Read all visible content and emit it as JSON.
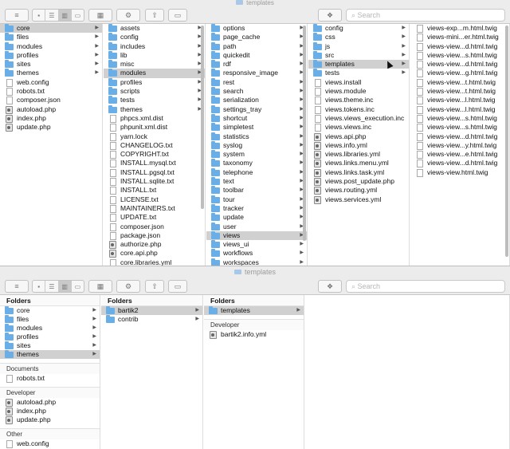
{
  "window_title": "templates",
  "search_placeholder": "Search",
  "toolbar": {
    "back_glyph": "≡",
    "view_list": "☰",
    "view_icons": "▦",
    "view_columns": "▥",
    "view_gallery": "▭",
    "arrange": "▦",
    "action": "⚙",
    "share": "⇧",
    "tags": "▭",
    "dropbox": "❖"
  },
  "win1": {
    "columns": [
      {
        "items": [
          {
            "label": "core",
            "type": "folder",
            "sel": true
          },
          {
            "label": "files",
            "type": "folder"
          },
          {
            "label": "modules",
            "type": "folder"
          },
          {
            "label": "profiles",
            "type": "folder"
          },
          {
            "label": "sites",
            "type": "folder"
          },
          {
            "label": "themes",
            "type": "folder"
          },
          {
            "label": "web.config",
            "type": "file"
          },
          {
            "label": "robots.txt",
            "type": "file"
          },
          {
            "label": "composer.json",
            "type": "file"
          },
          {
            "label": "autoload.php",
            "type": "php"
          },
          {
            "label": "index.php",
            "type": "php"
          },
          {
            "label": "update.php",
            "type": "php"
          }
        ]
      },
      {
        "items": [
          {
            "label": "assets",
            "type": "folder"
          },
          {
            "label": "config",
            "type": "folder"
          },
          {
            "label": "includes",
            "type": "folder"
          },
          {
            "label": "lib",
            "type": "folder"
          },
          {
            "label": "misc",
            "type": "folder"
          },
          {
            "label": "modules",
            "type": "folder",
            "sel": true
          },
          {
            "label": "profiles",
            "type": "folder"
          },
          {
            "label": "scripts",
            "type": "folder"
          },
          {
            "label": "tests",
            "type": "folder"
          },
          {
            "label": "themes",
            "type": "folder"
          },
          {
            "label": "phpcs.xml.dist",
            "type": "file"
          },
          {
            "label": "phpunit.xml.dist",
            "type": "file"
          },
          {
            "label": "yarn.lock",
            "type": "file"
          },
          {
            "label": "CHANGELOG.txt",
            "type": "file"
          },
          {
            "label": "COPYRIGHT.txt",
            "type": "file"
          },
          {
            "label": "INSTALL.mysql.txt",
            "type": "file"
          },
          {
            "label": "INSTALL.pgsql.txt",
            "type": "file"
          },
          {
            "label": "INSTALL.sqlite.txt",
            "type": "file"
          },
          {
            "label": "INSTALL.txt",
            "type": "file"
          },
          {
            "label": "LICENSE.txt",
            "type": "file"
          },
          {
            "label": "MAINTAINERS.txt",
            "type": "file"
          },
          {
            "label": "UPDATE.txt",
            "type": "file"
          },
          {
            "label": "composer.json",
            "type": "file"
          },
          {
            "label": "package.json",
            "type": "file"
          },
          {
            "label": "authorize.php",
            "type": "php"
          },
          {
            "label": "core.api.php",
            "type": "php"
          },
          {
            "label": "core.libraries.yml",
            "type": "file"
          }
        ]
      },
      {
        "items": [
          {
            "label": "options",
            "type": "folder"
          },
          {
            "label": "page_cache",
            "type": "folder"
          },
          {
            "label": "path",
            "type": "folder"
          },
          {
            "label": "quickedit",
            "type": "folder"
          },
          {
            "label": "rdf",
            "type": "folder"
          },
          {
            "label": "responsive_image",
            "type": "folder"
          },
          {
            "label": "rest",
            "type": "folder"
          },
          {
            "label": "search",
            "type": "folder"
          },
          {
            "label": "serialization",
            "type": "folder"
          },
          {
            "label": "settings_tray",
            "type": "folder"
          },
          {
            "label": "shortcut",
            "type": "folder"
          },
          {
            "label": "simpletest",
            "type": "folder"
          },
          {
            "label": "statistics",
            "type": "folder"
          },
          {
            "label": "syslog",
            "type": "folder"
          },
          {
            "label": "system",
            "type": "folder"
          },
          {
            "label": "taxonomy",
            "type": "folder"
          },
          {
            "label": "telephone",
            "type": "folder"
          },
          {
            "label": "text",
            "type": "folder"
          },
          {
            "label": "toolbar",
            "type": "folder"
          },
          {
            "label": "tour",
            "type": "folder"
          },
          {
            "label": "tracker",
            "type": "folder"
          },
          {
            "label": "update",
            "type": "folder"
          },
          {
            "label": "user",
            "type": "folder"
          },
          {
            "label": "views",
            "type": "folder",
            "sel": true
          },
          {
            "label": "views_ui",
            "type": "folder"
          },
          {
            "label": "workflows",
            "type": "folder"
          },
          {
            "label": "workspaces",
            "type": "folder"
          }
        ]
      },
      {
        "items": [
          {
            "label": "config",
            "type": "folder"
          },
          {
            "label": "css",
            "type": "folder"
          },
          {
            "label": "js",
            "type": "folder"
          },
          {
            "label": "src",
            "type": "folder"
          },
          {
            "label": "templates",
            "type": "folder",
            "sel": true
          },
          {
            "label": "tests",
            "type": "folder"
          },
          {
            "label": "views.install",
            "type": "file"
          },
          {
            "label": "views.module",
            "type": "file"
          },
          {
            "label": "views.theme.inc",
            "type": "file"
          },
          {
            "label": "views.tokens.inc",
            "type": "file"
          },
          {
            "label": "views.views_execution.inc",
            "type": "file"
          },
          {
            "label": "views.views.inc",
            "type": "file"
          },
          {
            "label": "views.api.php",
            "type": "php"
          },
          {
            "label": "views.info.yml",
            "type": "php"
          },
          {
            "label": "views.libraries.yml",
            "type": "php"
          },
          {
            "label": "views.links.menu.yml",
            "type": "php"
          },
          {
            "label": "views.links.task.yml",
            "type": "php"
          },
          {
            "label": "views.post_update.php",
            "type": "php"
          },
          {
            "label": "views.routing.yml",
            "type": "php"
          },
          {
            "label": "views.services.yml",
            "type": "php"
          }
        ]
      },
      {
        "items": [
          {
            "label": "views-exp...m.html.twig",
            "type": "file"
          },
          {
            "label": "views-mini...er.html.twig",
            "type": "file"
          },
          {
            "label": "views-view...d.html.twig",
            "type": "file"
          },
          {
            "label": "views-view...s.html.twig",
            "type": "file"
          },
          {
            "label": "views-view...d.html.twig",
            "type": "file"
          },
          {
            "label": "views-view...g.html.twig",
            "type": "file"
          },
          {
            "label": "views-view...t.html.twig",
            "type": "file"
          },
          {
            "label": "views-view...t.html.twig",
            "type": "file"
          },
          {
            "label": "views-view...l.html.twig",
            "type": "file"
          },
          {
            "label": "views-view...l.html.twig",
            "type": "file"
          },
          {
            "label": "views-view...s.html.twig",
            "type": "file"
          },
          {
            "label": "views-view...s.html.twig",
            "type": "file"
          },
          {
            "label": "views-view...d.html.twig",
            "type": "file"
          },
          {
            "label": "views-view...y.html.twig",
            "type": "file"
          },
          {
            "label": "views-view...e.html.twig",
            "type": "file"
          },
          {
            "label": "views-view...d.html.twig",
            "type": "file"
          },
          {
            "label": "views-view.html.twig",
            "type": "file"
          }
        ]
      }
    ]
  },
  "win2": {
    "col1": {
      "header": "Folders",
      "folders": [
        {
          "label": "core",
          "type": "folder"
        },
        {
          "label": "files",
          "type": "folder"
        },
        {
          "label": "modules",
          "type": "folder"
        },
        {
          "label": "profiles",
          "type": "folder"
        },
        {
          "label": "sites",
          "type": "folder"
        },
        {
          "label": "themes",
          "type": "folder",
          "sel": true
        }
      ],
      "groups": [
        {
          "title": "Documents",
          "items": [
            {
              "label": "robots.txt",
              "type": "file"
            }
          ]
        },
        {
          "title": "Developer",
          "items": [
            {
              "label": "autoload.php",
              "type": "php"
            },
            {
              "label": "index.php",
              "type": "php"
            },
            {
              "label": "update.php",
              "type": "php"
            }
          ]
        },
        {
          "title": "Other",
          "items": [
            {
              "label": "web.config",
              "type": "file"
            }
          ]
        }
      ]
    },
    "col2": {
      "header": "Folders",
      "folders": [
        {
          "label": "bartik2",
          "type": "folder",
          "sel": true
        },
        {
          "label": "contrib",
          "type": "folder"
        }
      ]
    },
    "col3": {
      "header": "Folders",
      "folders": [
        {
          "label": "templates",
          "type": "folder",
          "sel": true
        }
      ],
      "groups": [
        {
          "title": "Developer",
          "items": [
            {
              "label": "bartik2.info.yml",
              "type": "php"
            }
          ]
        }
      ]
    }
  }
}
